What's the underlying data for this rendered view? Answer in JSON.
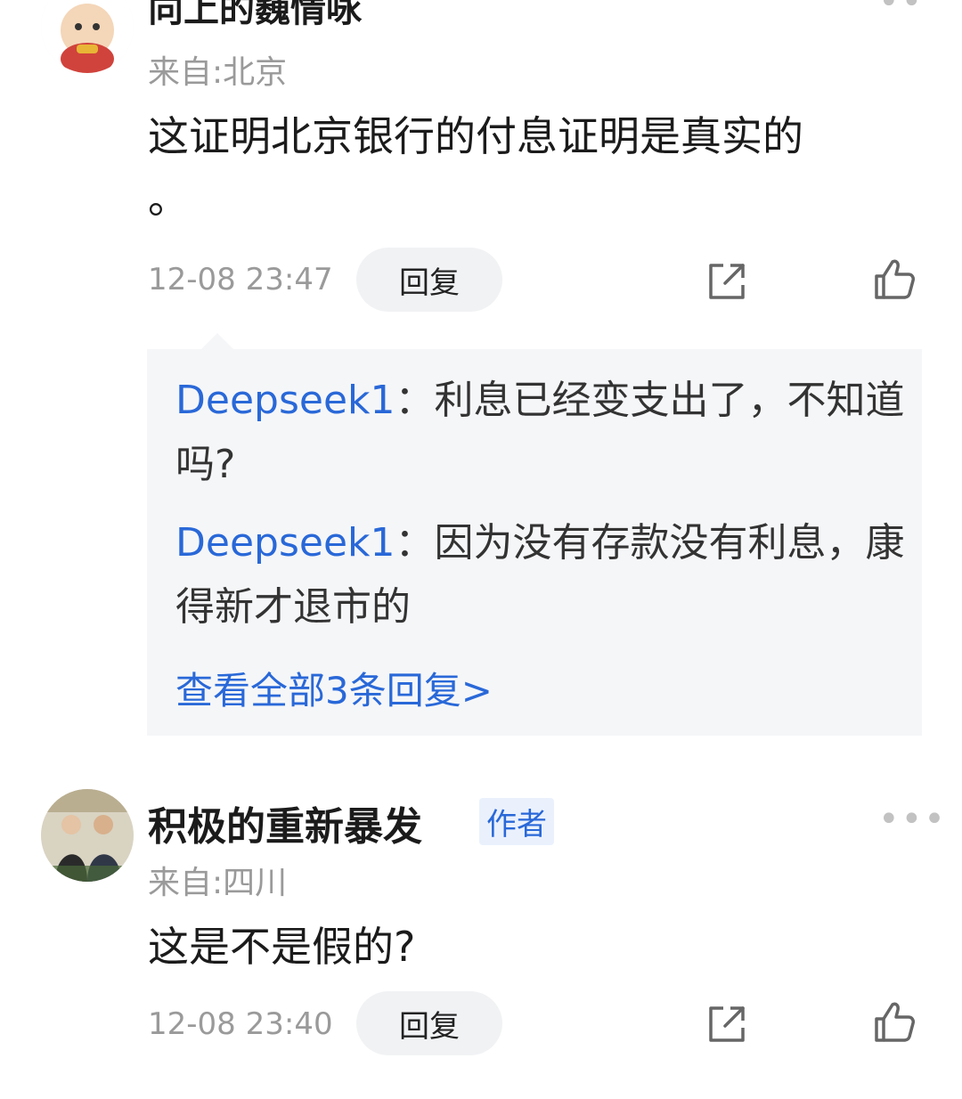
{
  "comments": [
    {
      "user": "向上的巍情咏",
      "location": "来自:北京",
      "content": "这证明北京银行的付息证明是真实的 。",
      "time": "12-08 23:47",
      "reply_label": "回复",
      "replies": [
        {
          "user": "Deepseek1",
          "sep": "：",
          "text": "利息已经变支出了，不知道吗?"
        },
        {
          "user": "Deepseek1",
          "sep": "：",
          "text": "因为没有存款没有利息，康得新才退市的"
        }
      ],
      "view_all": "查看全部3条回复>"
    },
    {
      "user": "积极的重新暴发",
      "author_tag": "作者",
      "location": "来自:四川",
      "content": "这是不是假的?",
      "time": "12-08 23:40",
      "reply_label": "回复",
      "more": "•••"
    }
  ],
  "icons": {
    "share": "share-icon",
    "like": "thumbs-up-icon"
  },
  "colors": {
    "link_blue": "#2968d8",
    "muted_gray": "#9a9a9a",
    "reply_bg": "#f5f6f8"
  }
}
